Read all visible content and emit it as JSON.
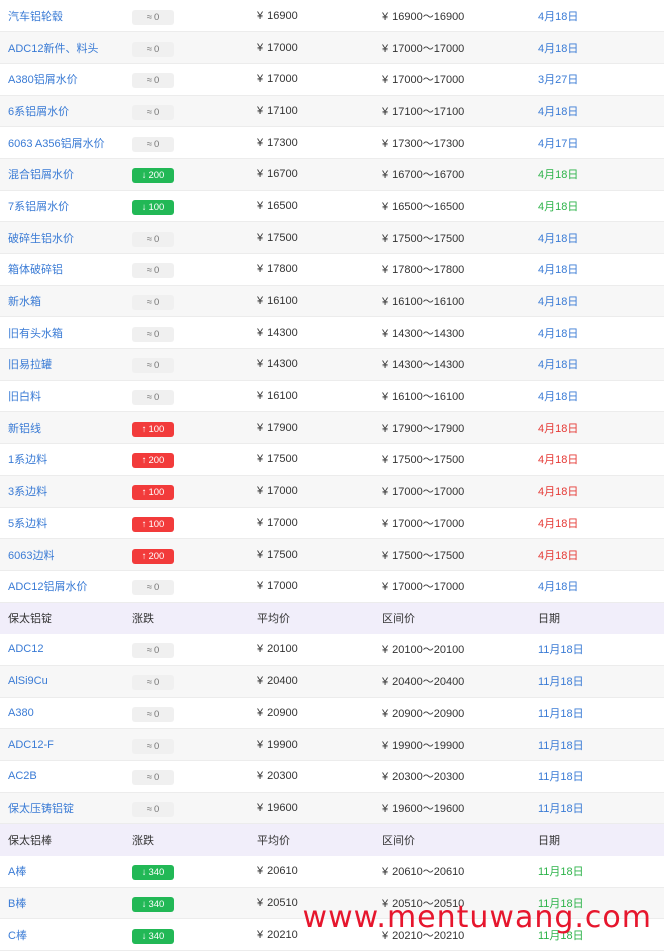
{
  "currency": "¥",
  "colors": {
    "link": "#3a7bd5",
    "up": "#f23b3b",
    "down": "#22b856",
    "flat": "#f0f0f0"
  },
  "icons": {
    "flat": "≈",
    "up": "↑",
    "down": "↓"
  },
  "section1": {
    "rows": [
      {
        "name": "汽车铝轮毂",
        "change": "0",
        "dir": "flat",
        "avg": "16900",
        "range": "16900～16900",
        "date": "4月18日"
      },
      {
        "name": "ADC12新件、料头",
        "change": "0",
        "dir": "flat",
        "avg": "17000",
        "range": "17000～17000",
        "date": "4月18日"
      },
      {
        "name": "A380铝屑水价",
        "change": "0",
        "dir": "flat",
        "avg": "17000",
        "range": "17000～17000",
        "date": "3月27日"
      },
      {
        "name": "6系铝屑水价",
        "change": "0",
        "dir": "flat",
        "avg": "17100",
        "range": "17100～17100",
        "date": "4月18日"
      },
      {
        "name": "6063 A356铝屑水价",
        "change": "0",
        "dir": "flat",
        "avg": "17300",
        "range": "17300～17300",
        "date": "4月17日"
      },
      {
        "name": "混合铝屑水价",
        "change": "200",
        "dir": "down",
        "avg": "16700",
        "range": "16700～16700",
        "date": "4月18日"
      },
      {
        "name": "7系铝屑水价",
        "change": "100",
        "dir": "down",
        "avg": "16500",
        "range": "16500～16500",
        "date": "4月18日"
      },
      {
        "name": "破碎生铝水价",
        "change": "0",
        "dir": "flat",
        "avg": "17500",
        "range": "17500～17500",
        "date": "4月18日"
      },
      {
        "name": "箱体破碎铝",
        "change": "0",
        "dir": "flat",
        "avg": "17800",
        "range": "17800～17800",
        "date": "4月18日"
      },
      {
        "name": "新水箱",
        "change": "0",
        "dir": "flat",
        "avg": "16100",
        "range": "16100～16100",
        "date": "4月18日"
      },
      {
        "name": "旧有头水箱",
        "change": "0",
        "dir": "flat",
        "avg": "14300",
        "range": "14300～14300",
        "date": "4月18日"
      },
      {
        "name": "旧易拉罐",
        "change": "0",
        "dir": "flat",
        "avg": "14300",
        "range": "14300～14300",
        "date": "4月18日"
      },
      {
        "name": "旧白料",
        "change": "0",
        "dir": "flat",
        "avg": "16100",
        "range": "16100～16100",
        "date": "4月18日"
      },
      {
        "name": "新铝线",
        "change": "100",
        "dir": "up",
        "avg": "17900",
        "range": "17900～17900",
        "date": "4月18日"
      },
      {
        "name": "1系边料",
        "change": "200",
        "dir": "up",
        "avg": "17500",
        "range": "17500～17500",
        "date": "4月18日"
      },
      {
        "name": "3系边料",
        "change": "100",
        "dir": "up",
        "avg": "17000",
        "range": "17000～17000",
        "date": "4月18日"
      },
      {
        "name": "5系边料",
        "change": "100",
        "dir": "up",
        "avg": "17000",
        "range": "17000～17000",
        "date": "4月18日"
      },
      {
        "name": "6063边料",
        "change": "200",
        "dir": "up",
        "avg": "17500",
        "range": "17500～17500",
        "date": "4月18日"
      },
      {
        "name": "ADC12铝屑水价",
        "change": "0",
        "dir": "flat",
        "avg": "17000",
        "range": "17000～17000",
        "date": "4月18日"
      }
    ]
  },
  "section2": {
    "header": {
      "name": "保太铝锭",
      "change": "涨跌",
      "avg": "平均价",
      "range": "区间价",
      "date": "日期"
    },
    "rows": [
      {
        "name": "ADC12",
        "change": "0",
        "dir": "flat",
        "avg": "20100",
        "range": "20100～20100",
        "date": "11月18日"
      },
      {
        "name": "AlSi9Cu",
        "change": "0",
        "dir": "flat",
        "avg": "20400",
        "range": "20400～20400",
        "date": "11月18日"
      },
      {
        "name": "A380",
        "change": "0",
        "dir": "flat",
        "avg": "20900",
        "range": "20900～20900",
        "date": "11月18日"
      },
      {
        "name": "ADC12-F",
        "change": "0",
        "dir": "flat",
        "avg": "19900",
        "range": "19900～19900",
        "date": "11月18日"
      },
      {
        "name": "AC2B",
        "change": "0",
        "dir": "flat",
        "avg": "20300",
        "range": "20300～20300",
        "date": "11月18日"
      },
      {
        "name": "保太压铸铝锭",
        "change": "0",
        "dir": "flat",
        "avg": "19600",
        "range": "19600～19600",
        "date": "11月18日"
      }
    ]
  },
  "section3": {
    "header": {
      "name": "保太铝棒",
      "change": "涨跌",
      "avg": "平均价",
      "range": "区间价",
      "date": "日期"
    },
    "rows": [
      {
        "name": "A棒",
        "change": "340",
        "dir": "down",
        "avg": "20610",
        "range": "20610～20610",
        "date": "11月18日"
      },
      {
        "name": "B棒",
        "change": "340",
        "dir": "down",
        "avg": "20510",
        "range": "20510～20510",
        "date": "11月18日"
      },
      {
        "name": "C棒",
        "change": "340",
        "dir": "down",
        "avg": "20210",
        "range": "20210～20210",
        "date": "11月18日"
      }
    ]
  },
  "watermark": "www.mentuwang.com"
}
